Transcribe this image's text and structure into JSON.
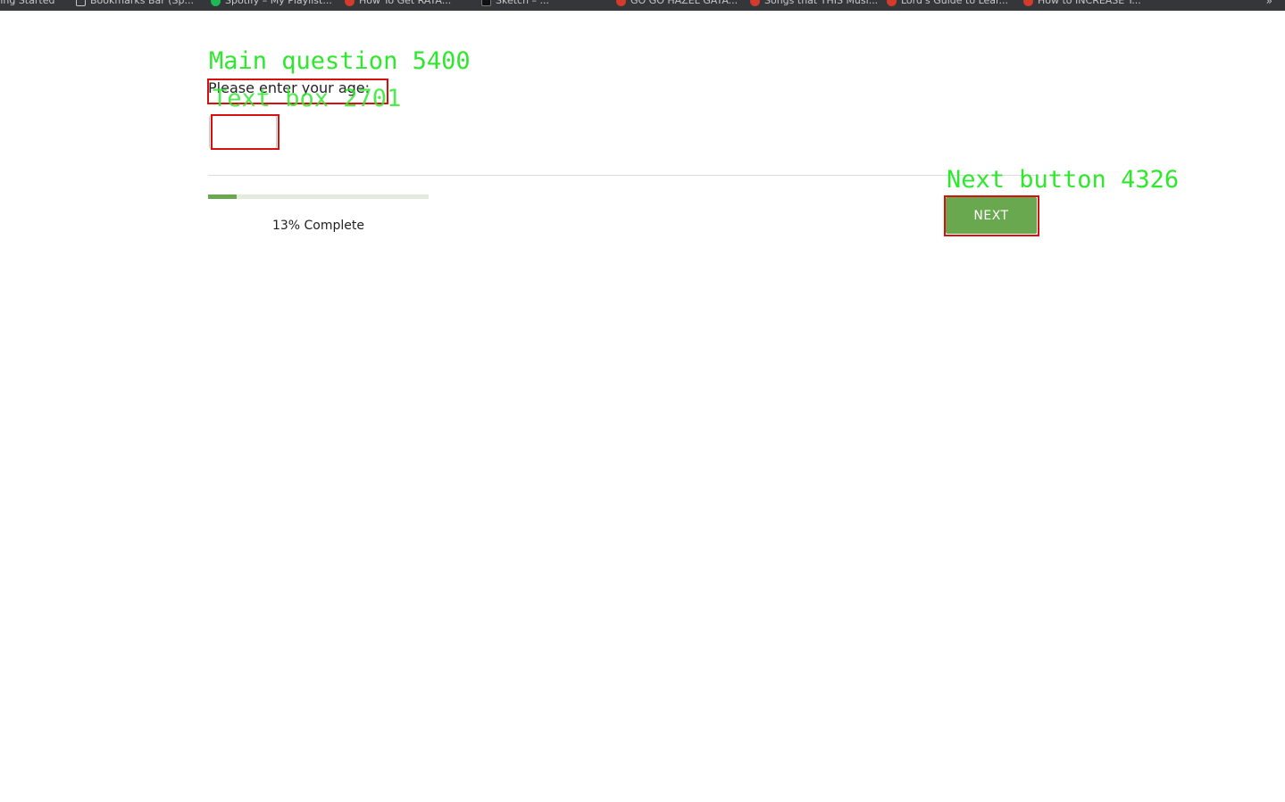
{
  "browser": {
    "bookmarks": [
      {
        "label": "ting Started",
        "icon": "none"
      },
      {
        "label": "Bookmarks Bar (Sp...",
        "icon": "folder-icon"
      },
      {
        "label": "Spotify – My Playlist...",
        "icon": "spotify-icon"
      },
      {
        "label": "How To Get RATA...",
        "icon": "youtube-icon"
      },
      {
        "label": "Sketch – ...",
        "icon": "app-icon"
      },
      {
        "label": "GO GO HAZEL GATA...",
        "icon": "youtube-icon"
      },
      {
        "label": "Songs that THIS Musi...",
        "icon": "youtube-icon"
      },
      {
        "label": "Lord's Guide to Lear...",
        "icon": "youtube-icon"
      },
      {
        "label": "How to INCREASE Y...",
        "icon": "youtube-icon"
      }
    ],
    "more_label": "»"
  },
  "annotations": {
    "main_question": "Main question 5400",
    "text_box": "Text box 2701",
    "next_button": "Next button 4326",
    "box_color": "#d91010",
    "label_color": "#2ee82e"
  },
  "survey": {
    "question": "Please enter your age:",
    "age_input": {
      "value": "",
      "placeholder": ""
    },
    "progress": {
      "percent": 13,
      "label": "13% Complete"
    },
    "next_label": "NEXT",
    "accent_color": "#6aa84f"
  }
}
